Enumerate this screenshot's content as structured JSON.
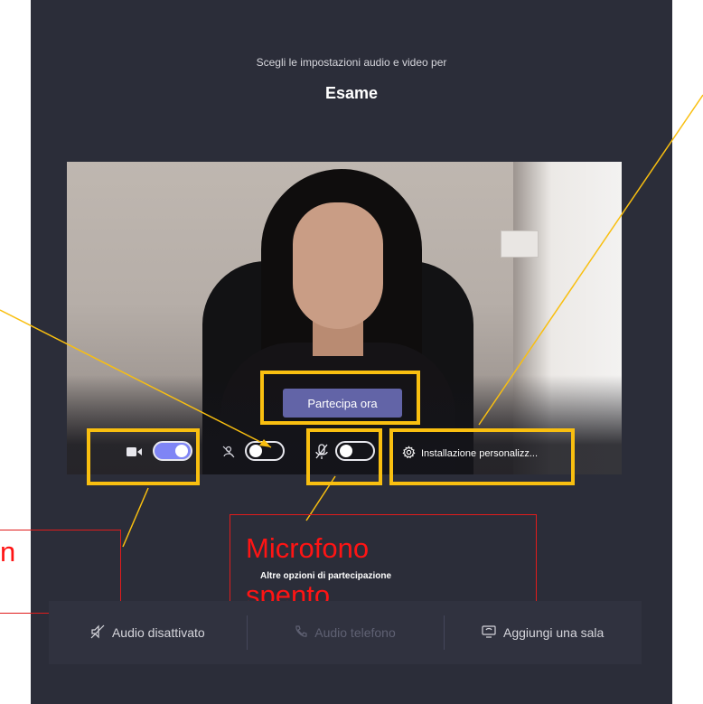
{
  "header": {
    "subtitle": "Scegli le impostazioni audio e video per",
    "meeting_title": "Esame"
  },
  "preview": {
    "join_button_label": "Partecipa ora"
  },
  "controls": {
    "camera": {
      "icon": "video-camera-icon",
      "state": "on"
    },
    "background_blur": {
      "icon": "background-blur-icon",
      "state": "off"
    },
    "microphone": {
      "icon": "mic-off-icon",
      "state": "off"
    },
    "custom_setup": {
      "icon": "gear-icon",
      "label": "Installazione personalizz..."
    }
  },
  "annotations": {
    "mic_label": "Microfono spento",
    "mic_label_line1": "Microfono",
    "mic_label_line2": "spento",
    "left_partial_label": "n",
    "highlight_color": "#f9bf10",
    "label_color": "#ff1414"
  },
  "join_options": {
    "heading": "Altre opzioni di partecipazione",
    "items": [
      {
        "icon": "speaker-off-icon",
        "label": "Audio disattivato",
        "enabled": true
      },
      {
        "icon": "phone-icon",
        "label": "Audio telefono",
        "enabled": false
      },
      {
        "icon": "room-cast-icon",
        "label": "Aggiungi una sala",
        "enabled": true
      }
    ]
  },
  "colors": {
    "background": "#2b2d39",
    "accent": "#6264a7",
    "toggle_on": "#7f85f5"
  }
}
